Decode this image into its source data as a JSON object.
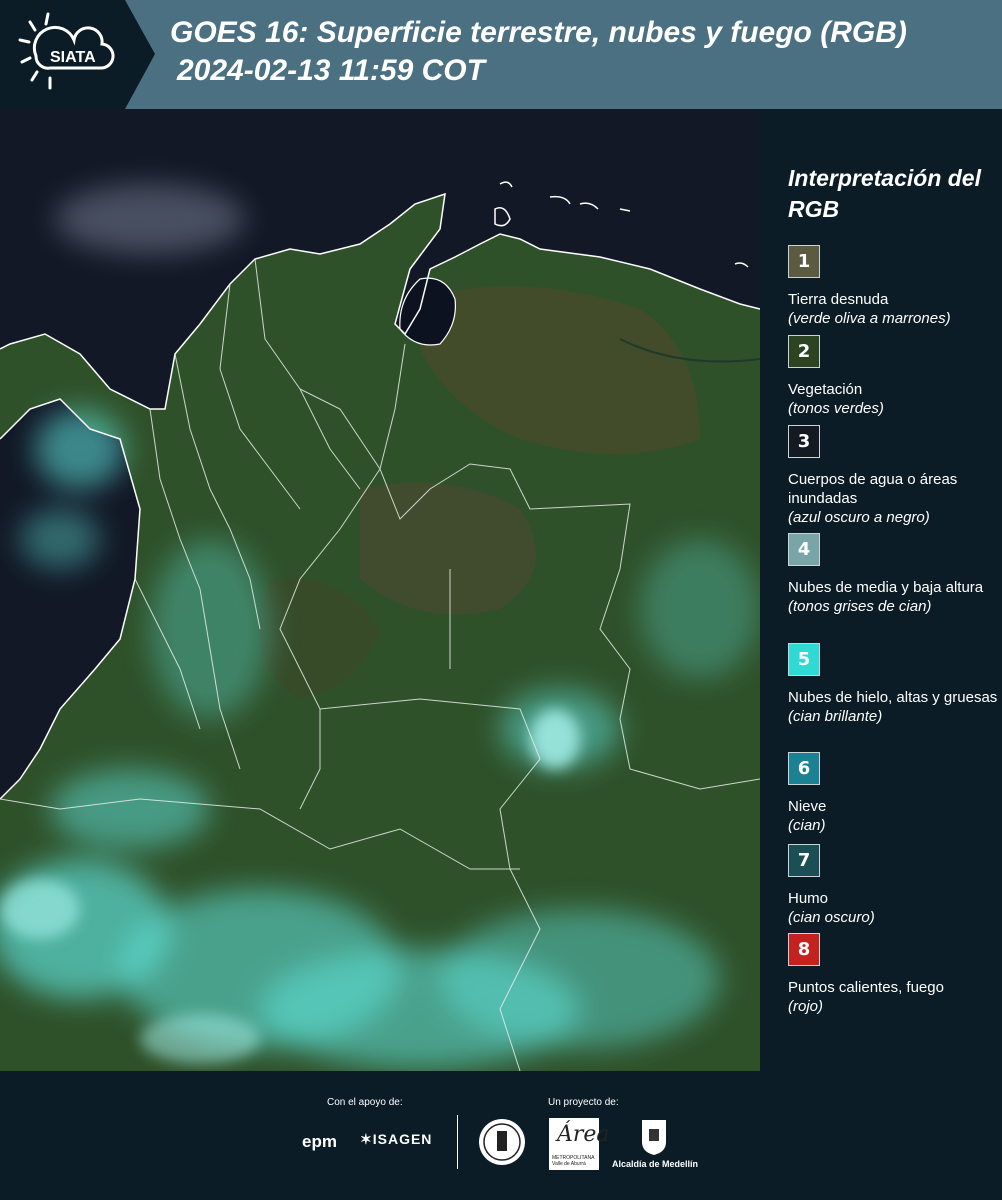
{
  "header": {
    "logo_text": "SIATA",
    "title_line1": "GOES 16: Superficie terrestre, nubes y fuego (RGB)",
    "title_line2": "2024-02-13 11:59 COT",
    "background_color": "#4b7082"
  },
  "legend": {
    "title": "Interpretación del RGB",
    "items": [
      {
        "number": "1",
        "label": "Tierra desnuda",
        "description": "(verde oliva a marrones)",
        "color": "#5c5a40"
      },
      {
        "number": "2",
        "label": "Vegetación",
        "description": "(tonos verdes)",
        "color": "#2c4421"
      },
      {
        "number": "3",
        "label": "Cuerpos de agua o áreas inundadas",
        "description": "(azul oscuro a negro)",
        "color": "#141a22"
      },
      {
        "number": "4",
        "label": "Nubes de media y baja altura",
        "description": "(tonos grises de cian)",
        "color": "#7aa5a8"
      },
      {
        "number": "5",
        "label": "Nubes de hielo, altas y gruesas",
        "description": "(cian brillante)",
        "color": "#2fd9d4"
      },
      {
        "number": "6",
        "label": "Nieve",
        "description": "(cian)",
        "color": "#1c8193"
      },
      {
        "number": "7",
        "label": "Humo",
        "description": "(cian oscuro)",
        "color": "#1c4e56"
      },
      {
        "number": "8",
        "label": "Puntos calientes, fuego",
        "description": "(rojo)",
        "color": "#c4221f"
      }
    ]
  },
  "footer": {
    "support_label": "Con el apoyo de:",
    "project_label": "Un proyecto de:",
    "epm_text": "epm",
    "isagen_text": "ISAGEN",
    "area_text": "Área",
    "area_subtext": "METROPOLITANA Valle de Aburrá",
    "medellin_text": "Alcaldía de Medellín"
  },
  "map": {
    "land_color": "#2e4f2a",
    "ocean_color": "#121826",
    "cloud_color": "#5fe3dd"
  }
}
